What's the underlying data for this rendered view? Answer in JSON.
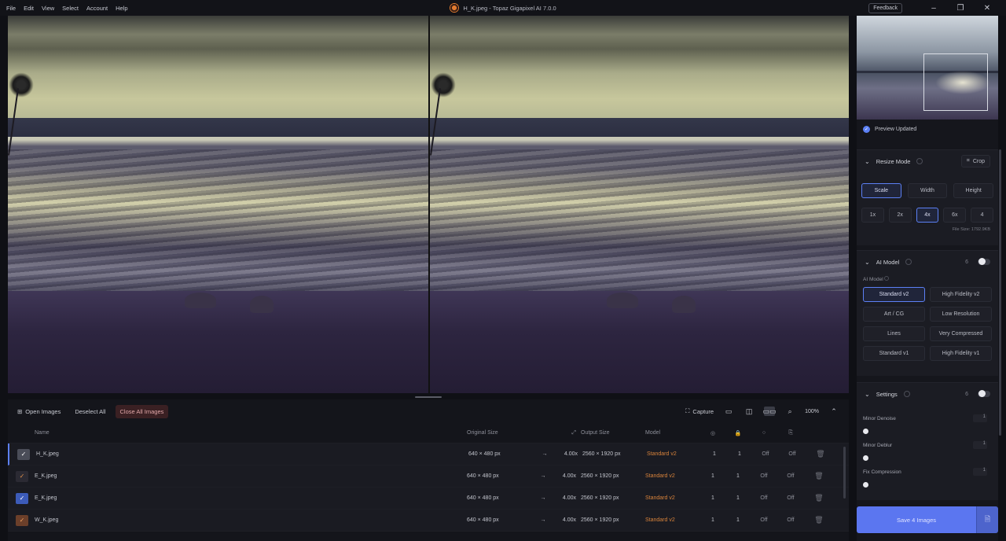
{
  "menu": [
    "File",
    "Edit",
    "View",
    "Select",
    "Account",
    "Help"
  ],
  "window_title": "H_K.jpeg - Topaz Gigapixel AI 7.0.0",
  "feedback_label": "Feedback",
  "sidebar": {
    "preview_updated": "Preview Updated",
    "resize_mode": {
      "title": "Resize Mode",
      "crop_label": "Crop",
      "modes": [
        "Scale",
        "Width",
        "Height"
      ],
      "scales": [
        "1x",
        "2x",
        "4x",
        "6x",
        "4"
      ],
      "file_size": "File Size: 1792.9KB"
    },
    "ai_model": {
      "title": "AI Model",
      "number": "6",
      "sub_label": "AI Model",
      "models": [
        "Standard v2",
        "High Fidelity v2",
        "Art / CG",
        "Low Resolution",
        "Lines",
        "Very Compressed",
        "Standard v1",
        "High Fidelity v1"
      ]
    },
    "settings": {
      "title": "Settings",
      "number": "6",
      "sliders": [
        {
          "name": "Minor Denoise",
          "value": "1"
        },
        {
          "name": "Minor Deblur",
          "value": "1"
        },
        {
          "name": "Fix Compression",
          "value": "1"
        }
      ]
    },
    "save_label": "Save 4 Images"
  },
  "toolbar": {
    "open_images": "Open Images",
    "deselect_all": "Deselect All",
    "close_all": "Close All Images",
    "capture": "Capture",
    "zoom": "100%"
  },
  "table": {
    "headers": {
      "name": "Name",
      "original": "Original Size",
      "output": "Output Size",
      "model": "Model"
    },
    "rows": [
      {
        "name": "H_K.jpeg",
        "orig": "640 × 480 px",
        "arrow": "→",
        "scale": "4.00x",
        "out": "2560 × 1920 px",
        "model": "Standard v2",
        "a": "1",
        "b": "1",
        "c": "Off",
        "d": "Off",
        "color": "#4a4d58"
      },
      {
        "name": "E_K.jpeg",
        "orig": "640 × 480 px",
        "arrow": "→",
        "scale": "4.00x",
        "out": "2560 × 1920 px",
        "model": "Standard v2",
        "a": "1",
        "b": "1",
        "c": "Off",
        "d": "Off",
        "color": "#2b2a33"
      },
      {
        "name": "E_K.jpeg",
        "orig": "640 × 480 px",
        "arrow": "→",
        "scale": "4.00x",
        "out": "2560 × 1920 px",
        "model": "Standard v2",
        "a": "1",
        "b": "1",
        "c": "Off",
        "d": "Off",
        "color": "#3c5bb8"
      },
      {
        "name": "W_K.jpeg",
        "orig": "640 × 480 px",
        "arrow": "→",
        "scale": "4.00x",
        "out": "2560 × 1920 px",
        "model": "Standard v2",
        "a": "1",
        "b": "1",
        "c": "Off",
        "d": "Off",
        "color": "#6b3f2a"
      }
    ]
  },
  "colors": {
    "accent": "#5c80f5",
    "model_orange": "#d8833b",
    "save_button": "#5b76f0"
  }
}
